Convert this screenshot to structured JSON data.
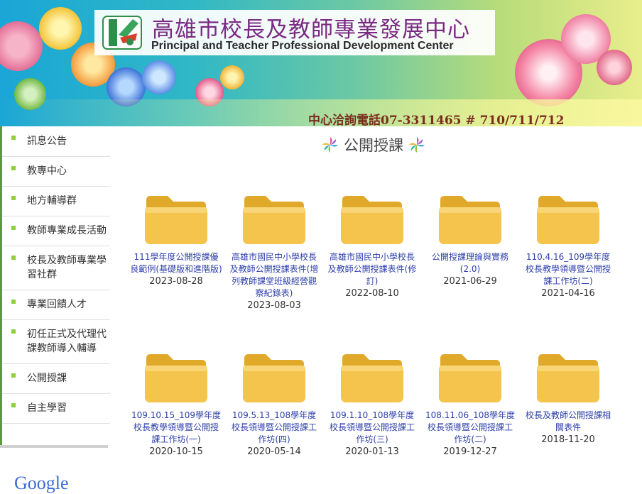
{
  "header": {
    "title_zh": "高雄市校長及教師專業發展中心",
    "title_en": "Principal and Teacher Professional Development Center",
    "phone": "中心洽詢電話07-3311465 # 710/711/712"
  },
  "sidebar": {
    "items": [
      {
        "label": "訊息公告"
      },
      {
        "label": "教專中心"
      },
      {
        "label": "地方輔導群"
      },
      {
        "label": "教師專業成長活動"
      },
      {
        "label": "校長及教師專業學習社群"
      },
      {
        "label": "專業回饋人才"
      },
      {
        "label": "初任正式及代理代課教師導入輔導"
      },
      {
        "label": "公開授課"
      },
      {
        "label": "自主學習"
      }
    ],
    "google_label": "Google"
  },
  "main": {
    "section_title": "公開授課",
    "folders": [
      {
        "title": "111學年度公開授課優良範例(基礎版和進階版)",
        "date": "2023-08-28"
      },
      {
        "title": "高雄市國民中小學校長及教師公開授課表件(增列教師課堂班級經營觀察紀錄表)",
        "date": "2023-08-03"
      },
      {
        "title": "高雄市國民中小學校長及教師公開授課表件(修訂)",
        "date": "2022-08-10"
      },
      {
        "title": "公開授課理論與實務(2.0)",
        "date": "2021-06-29"
      },
      {
        "title": "110.4.16_109學年度校長教學領導暨公開授課工作坊(二)",
        "date": "2021-04-16"
      },
      {
        "title": "109.10.15_109學年度校長教學領導暨公開授課工作坊(一)",
        "date": "2020-10-15"
      },
      {
        "title": "109.5.13_108學年度校長領導暨公開授課工作坊(四)",
        "date": "2020-05-14"
      },
      {
        "title": "109.1.10_108學年度校長領導暨公開授課工作坊(三)",
        "date": "2020-01-13"
      },
      {
        "title": "108.11.06_108學年度校長領導暨公開授課工作坊(二)",
        "date": "2019-12-27"
      },
      {
        "title": "校長及教師公開授課相關表件",
        "date": "2018-11-20"
      }
    ]
  },
  "colors": {
    "title_purple": "#7a2a82",
    "link_blue": "#2c3ea8",
    "bullet_green": "#8fcf3c",
    "folder_yellow": "#f2c24a"
  }
}
